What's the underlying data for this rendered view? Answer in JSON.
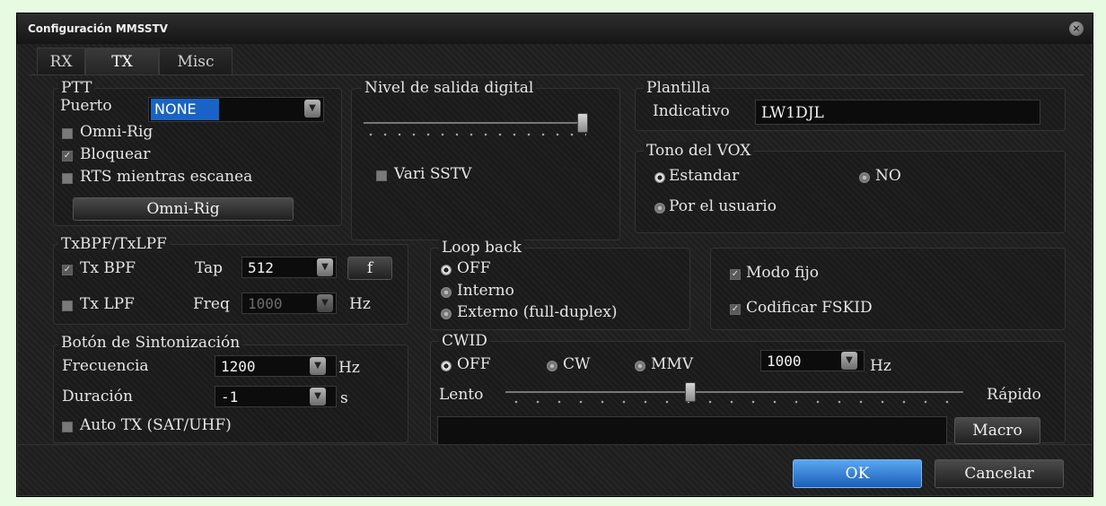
{
  "window": {
    "title": "Configuración MMSSTV"
  },
  "tabs": [
    {
      "label": "RX"
    },
    {
      "label": "TX"
    },
    {
      "label": "Misc"
    }
  ],
  "ptt": {
    "title": "PTT",
    "port_label": "Puerto",
    "port_value": "NONE",
    "omni_rig_check": "Omni-Rig",
    "lock_check": "Bloquear",
    "rts_check": "RTS mientras escanea",
    "omni_rig_button": "Omni-Rig"
  },
  "digital": {
    "title": "Nivel de salida digital",
    "vari_sstv": "Vari SSTV"
  },
  "template": {
    "title": "Plantilla",
    "callsign_label": "Indicativo",
    "callsign_value": "LW1DJL"
  },
  "vox": {
    "title": "Tono del VOX",
    "standard": "Estandar",
    "no": "NO",
    "user": "Por el usuario"
  },
  "filters": {
    "title": "TxBPF/TxLPF",
    "txbpf": "Tx BPF",
    "tap_label": "Tap",
    "tap_value": "512",
    "f_button": "f",
    "txlpf": "Tx LPF",
    "freq_label": "Freq",
    "freq_value": "1000",
    "hz": "Hz"
  },
  "loopback": {
    "title": "Loop back",
    "off": "OFF",
    "internal": "Interno",
    "external": "Externo (full-duplex)"
  },
  "mode": {
    "fixed": "Modo fijo",
    "fskid": "Codificar FSKID"
  },
  "tune": {
    "title": "Botón de Sintonización",
    "freq_label": "Frecuencia",
    "freq_value": "1200",
    "freq_unit": "Hz",
    "dur_label": "Duración",
    "dur_value": "-1",
    "dur_unit": "s",
    "auto_tx": "Auto TX (SAT/UHF)"
  },
  "cwid": {
    "title": "CWID",
    "off": "OFF",
    "cw": "CW",
    "mmv": "MMV",
    "freq_value": "1000",
    "freq_unit": "Hz",
    "slow": "Lento",
    "fast": "Rápido",
    "macro_button": "Macro"
  },
  "footer": {
    "ok": "OK",
    "cancel": "Cancelar"
  }
}
